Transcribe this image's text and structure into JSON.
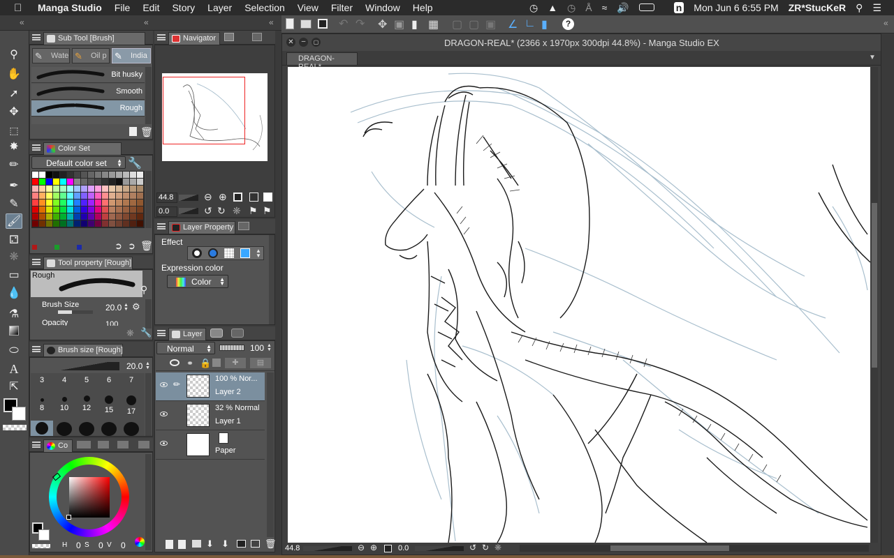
{
  "menubar": {
    "app_name": "Manga Studio",
    "items": [
      "File",
      "Edit",
      "Story",
      "Layer",
      "Selection",
      "View",
      "Filter",
      "Window",
      "Help"
    ],
    "clock": "Mon Jun 6  6:55 PM",
    "user": "ZR*StucKeR"
  },
  "subtool": {
    "tab_label": "Sub Tool [Brush]",
    "groups": [
      "Wate",
      "Oil p",
      "India"
    ],
    "brushes": [
      "Bit husky",
      "Smooth",
      "Rough"
    ]
  },
  "navigator": {
    "tab_label": "Navigator",
    "zoom": "44.8",
    "rotation": "0.0"
  },
  "colorset": {
    "tab_label": "Color Set",
    "set_name": "Default color set"
  },
  "layer_property": {
    "tab_label": "Layer Property",
    "effect_label": "Effect",
    "expression_label": "Expression color",
    "expression_value": "Color"
  },
  "tool_property": {
    "tab_label": "Tool property [Rough]",
    "preset_name": "Rough",
    "brush_size_label": "Brush Size",
    "brush_size_value": "20.0",
    "opacity_label": "Opacity",
    "opacity_value": "100"
  },
  "brush_size_panel": {
    "tab_label": "Brush size [Rough]",
    "current": "20.0",
    "row1": [
      "3",
      "4",
      "5",
      "6",
      "7"
    ],
    "row2": [
      "8",
      "10",
      "12",
      "15",
      "17"
    ]
  },
  "color_wheel": {
    "tab_label": "Co",
    "h": "0",
    "s": "0",
    "v": "0",
    "h_label": "H",
    "s_label": "S",
    "v_label": "V"
  },
  "layer_panel": {
    "tab_label": "Layer",
    "blend_mode": "Normal",
    "opacity": "100",
    "layers": [
      {
        "info": "100 % Nor...",
        "name": "Layer 2"
      },
      {
        "info": "32 % Normal",
        "name": "Layer 1"
      },
      {
        "info": "",
        "name": "Paper"
      }
    ]
  },
  "canvas": {
    "window_title": "DRAGON-REAL* (2366 x 1970px 300dpi 44.8%) - Manga Studio EX",
    "tab_label": "DRAGON-REAL*",
    "status_zoom": "44.8",
    "status_rotation": "0.0"
  },
  "colors": {
    "accent": "#6b7f90",
    "panel_bg": "#535353",
    "menubar_bg": "#2b2b2b",
    "sketch_blue": "#9fb8c8"
  }
}
